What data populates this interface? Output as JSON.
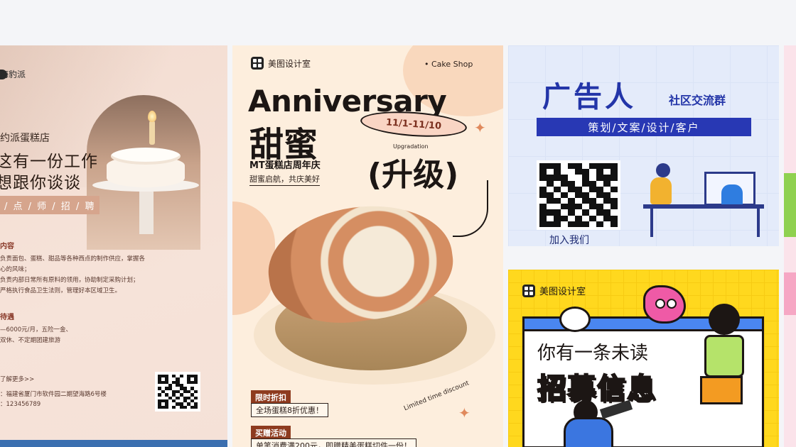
{
  "gallery": {
    "cards": [
      {
        "brand": "海豹派",
        "shop_name": "约派蛋糕店",
        "headline_line1": "这有一份工作",
        "headline_line2": "想跟你谈谈",
        "band": "/ 点 / 师 / 招 / 聘",
        "section_duty": "内容",
        "duty_lines": [
          "负责面包、蛋糕、甜品等各种西点的制作供应，掌握各",
          "心的风味；",
          "负责内部日常所有原料的领用，协助制定采购计划；",
          "严格执行食品卫生法则，管理好本区域卫生。"
        ],
        "section_benefit": "待遇",
        "benefit_lines": [
          "—6000元/月，五险一金、",
          "双休、不定期团建旅游"
        ],
        "more": "了解更多>>",
        "address": "：福建省厦门市软件园二期望海路6号楼",
        "phone": "：123456789"
      },
      {
        "logo": "美图设计室",
        "shop": "• Cake Shop",
        "title": "Anniversary",
        "sweet": "甜蜜",
        "date": "11/1-11/10",
        "upgradation": "Upgradation",
        "upgrade": "(升级)",
        "subtitle": "MT蛋糕店周年庆",
        "slogan": "甜蜜启航，共庆美好",
        "tag1": "限时折扣",
        "tag1_text": "全场蛋糕8折优惠！",
        "tag2": "买赠活动",
        "tag2_text": "单笔消费满200元，即赠精美蛋糕切件一份！",
        "limited": "Limited time discount"
      },
      {
        "title": "广告人",
        "subtitle": "社区交流群",
        "roles": "策划/文案/设计/客户",
        "join": "加入我们"
      },
      {
        "logo": "美图设计室",
        "message": "你有一条未读",
        "recruit": "招募信息"
      }
    ]
  },
  "colors": {
    "page_bg": "#f4f5f8",
    "cake_accent": "#8e3b1f",
    "ad_blue": "#2838b4",
    "recruit_yellow": "#ffd81e"
  }
}
